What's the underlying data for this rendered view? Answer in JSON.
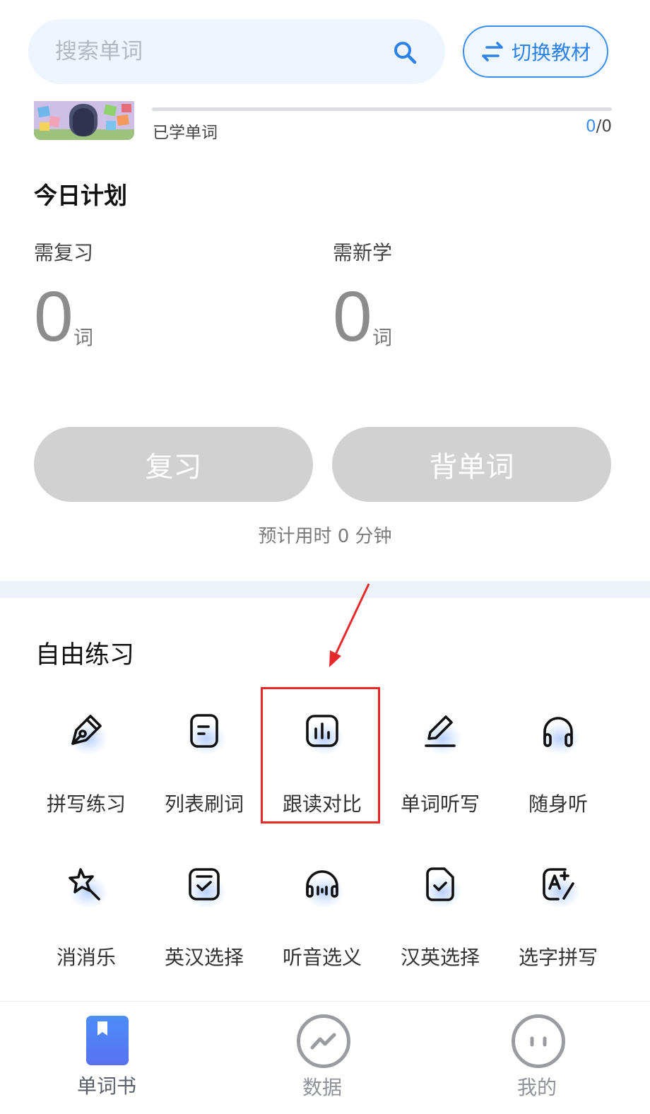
{
  "search": {
    "placeholder": "搜索单词",
    "icon": "search-icon"
  },
  "switch_button": {
    "label": "切换教材",
    "icon": "swap-arrows-icon"
  },
  "progress": {
    "label": "已学单词",
    "learned": "0",
    "separator": "/",
    "total": "0",
    "fraction": 0
  },
  "plan": {
    "title": "今日计划",
    "review": {
      "label": "需复习",
      "count": "0",
      "unit": "词"
    },
    "new": {
      "label": "需新学",
      "count": "0",
      "unit": "词"
    },
    "review_button": "复习",
    "learn_button": "背单词",
    "estimate": "预计用时 0 分钟"
  },
  "free_practice": {
    "title": "自由练习",
    "items": [
      {
        "label": "拼写练习",
        "icon": "pen-nib-icon"
      },
      {
        "label": "列表刷词",
        "icon": "list-card-icon"
      },
      {
        "label": "跟读对比",
        "icon": "bar-chart-icon"
      },
      {
        "label": "单词听写",
        "icon": "pencil-icon"
      },
      {
        "label": "随身听",
        "icon": "headphones-icon"
      },
      {
        "label": "消消乐",
        "icon": "star-wand-icon"
      },
      {
        "label": "英汉选择",
        "icon": "check-card-icon"
      },
      {
        "label": "听音选义",
        "icon": "audio-headset-icon"
      },
      {
        "label": "汉英选择",
        "icon": "check-document-icon"
      },
      {
        "label": "选字拼写",
        "icon": "letter-a-plus-icon"
      }
    ]
  },
  "nav": {
    "items": [
      {
        "label": "单词书",
        "icon": "bookmark-book-icon",
        "active": true
      },
      {
        "label": "数据",
        "icon": "trend-chart-icon",
        "active": false
      },
      {
        "label": "我的",
        "icon": "face-icon",
        "active": false
      }
    ]
  },
  "colors": {
    "accent": "#3b8ef0",
    "annotation": "#e8292b",
    "disabled_button": "#d1d1d1"
  }
}
